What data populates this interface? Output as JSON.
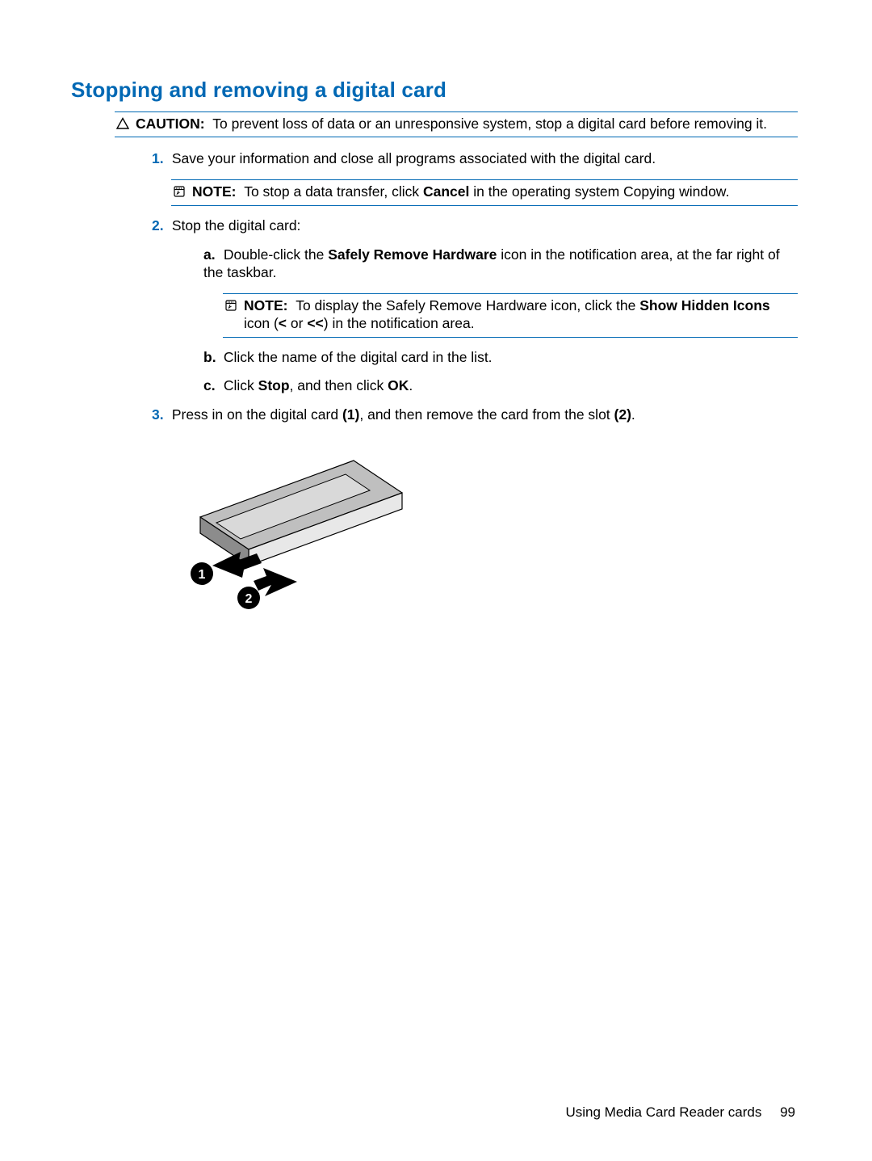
{
  "heading": "Stopping and removing a digital card",
  "caution_label": "CAUTION:",
  "caution_text": "To prevent loss of data or an unresponsive system, stop a digital card before removing it.",
  "step1": {
    "num": "1.",
    "text": "Save your information and close all programs associated with the digital card.",
    "note_label": "NOTE:",
    "note_pre": "To stop a data transfer, click ",
    "note_bold": "Cancel",
    "note_post": " in the operating system Copying window."
  },
  "step2": {
    "num": "2.",
    "text": "Stop the digital card:",
    "a_letter": "a.",
    "a_pre": "Double-click the ",
    "a_bold": "Safely Remove Hardware",
    "a_post": " icon in the notification area, at the far right of the taskbar.",
    "note_label": "NOTE:",
    "note_pre": "To display the Safely Remove Hardware icon, click the ",
    "note_bold": "Show Hidden Icons",
    "note_post_a": " icon (",
    "note_lt1": "<",
    "note_or": " or ",
    "note_lt2": "<<",
    "note_post_b": ") in the notification area.",
    "b_letter": "b.",
    "b_text": "Click the name of the digital card in the list.",
    "c_letter": "c.",
    "c_pre": "Click ",
    "c_b1": "Stop",
    "c_mid": ", and then click ",
    "c_b2": "OK",
    "c_post": "."
  },
  "step3": {
    "num": "3.",
    "pre": "Press in on the digital card ",
    "b1": "(1)",
    "mid": ", and then remove the card from the slot ",
    "b2": "(2)",
    "post": "."
  },
  "footer_text": "Using Media Card Reader cards",
  "page_number": "99"
}
